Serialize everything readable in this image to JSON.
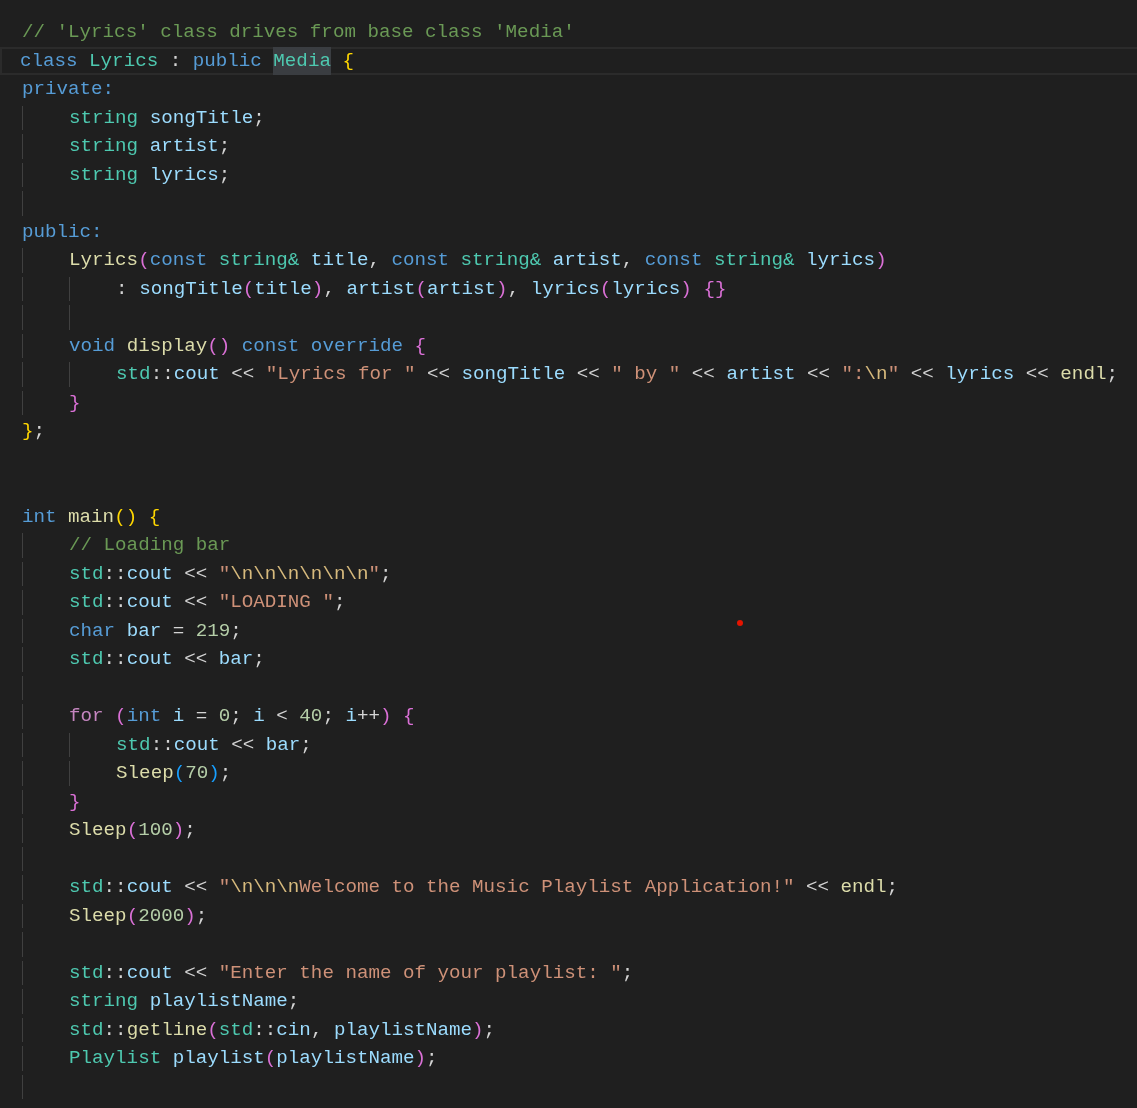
{
  "editor": {
    "lines": [
      {
        "kind": "code",
        "tokens": [
          {
            "kind": "comment",
            "text": "// 'Lyrics' class drives from base class 'Media'"
          }
        ]
      },
      {
        "kind": "code",
        "current": true,
        "tokens": [
          {
            "kind": "keyword",
            "text": "class "
          },
          {
            "kind": "type",
            "text": "Lyrics"
          },
          {
            "kind": "plain",
            "text": " : "
          },
          {
            "kind": "keyword",
            "text": "public "
          },
          {
            "kind": "type",
            "text": "Media",
            "highlighted": true
          },
          {
            "kind": "brace1",
            "text": " {"
          }
        ]
      },
      {
        "kind": "code",
        "tokens": [
          {
            "kind": "keyword",
            "text": "private:"
          }
        ]
      },
      {
        "kind": "code",
        "tokens": [
          {
            "kind": "type",
            "text": "    string"
          },
          {
            "kind": "variable",
            "text": " songTitle"
          },
          {
            "kind": "plain",
            "text": ";"
          }
        ]
      },
      {
        "kind": "code",
        "tokens": [
          {
            "kind": "type",
            "text": "    string"
          },
          {
            "kind": "variable",
            "text": " artist"
          },
          {
            "kind": "plain",
            "text": ";"
          }
        ]
      },
      {
        "kind": "code",
        "tokens": [
          {
            "kind": "type",
            "text": "    string"
          },
          {
            "kind": "variable",
            "text": " lyrics"
          },
          {
            "kind": "plain",
            "text": ";"
          }
        ]
      },
      {
        "kind": "blank"
      },
      {
        "kind": "code",
        "tokens": [
          {
            "kind": "keyword",
            "text": "public:"
          }
        ]
      },
      {
        "kind": "code",
        "tokens": [
          {
            "kind": "function",
            "text": "    Lyrics"
          },
          {
            "kind": "brace2",
            "text": "("
          },
          {
            "kind": "keyword",
            "text": "const "
          },
          {
            "kind": "type",
            "text": "string&"
          },
          {
            "kind": "variable",
            "text": " title"
          },
          {
            "kind": "plain",
            "text": ", "
          },
          {
            "kind": "keyword",
            "text": "const "
          },
          {
            "kind": "type",
            "text": "string&"
          },
          {
            "kind": "variable",
            "text": " artist"
          },
          {
            "kind": "plain",
            "text": ", "
          },
          {
            "kind": "keyword",
            "text": "const "
          },
          {
            "kind": "type",
            "text": "string&"
          },
          {
            "kind": "variable",
            "text": " lyrics"
          },
          {
            "kind": "brace2",
            "text": ")"
          }
        ]
      },
      {
        "kind": "code",
        "tokens": [
          {
            "kind": "plain",
            "text": "        : "
          },
          {
            "kind": "variable",
            "text": "songTitle"
          },
          {
            "kind": "brace2",
            "text": "("
          },
          {
            "kind": "variable",
            "text": "title"
          },
          {
            "kind": "brace2",
            "text": ")"
          },
          {
            "kind": "plain",
            "text": ", "
          },
          {
            "kind": "variable",
            "text": "artist"
          },
          {
            "kind": "brace2",
            "text": "("
          },
          {
            "kind": "variable",
            "text": "artist"
          },
          {
            "kind": "brace2",
            "text": ")"
          },
          {
            "kind": "plain",
            "text": ", "
          },
          {
            "kind": "variable",
            "text": "lyrics"
          },
          {
            "kind": "brace2",
            "text": "("
          },
          {
            "kind": "variable",
            "text": "lyrics"
          },
          {
            "kind": "brace2",
            "text": ")"
          },
          {
            "kind": "brace2",
            "text": " {}"
          }
        ]
      },
      {
        "kind": "blank"
      },
      {
        "kind": "code",
        "tokens": [
          {
            "kind": "keyword",
            "text": "    void "
          },
          {
            "kind": "function",
            "text": "display"
          },
          {
            "kind": "brace2",
            "text": "()"
          },
          {
            "kind": "keyword",
            "text": " const override "
          },
          {
            "kind": "brace2",
            "text": "{"
          }
        ]
      },
      {
        "kind": "code",
        "tokens": [
          {
            "kind": "type",
            "text": "        std"
          },
          {
            "kind": "plain",
            "text": "::"
          },
          {
            "kind": "variable",
            "text": "cout"
          },
          {
            "kind": "plain",
            "text": " << "
          },
          {
            "kind": "string",
            "text": "\"Lyrics for \""
          },
          {
            "kind": "plain",
            "text": " << "
          },
          {
            "kind": "variable",
            "text": "songTitle"
          },
          {
            "kind": "plain",
            "text": " << "
          },
          {
            "kind": "string",
            "text": "\" by \""
          },
          {
            "kind": "plain",
            "text": " << "
          },
          {
            "kind": "variable",
            "text": "artist"
          },
          {
            "kind": "plain",
            "text": " << "
          },
          {
            "kind": "string",
            "text": "\":"
          },
          {
            "kind": "escape",
            "text": "\\n"
          },
          {
            "kind": "string",
            "text": "\""
          },
          {
            "kind": "plain",
            "text": " << "
          },
          {
            "kind": "variable",
            "text": "lyrics"
          },
          {
            "kind": "plain",
            "text": " << "
          },
          {
            "kind": "function",
            "text": "endl"
          },
          {
            "kind": "plain",
            "text": ";"
          }
        ]
      },
      {
        "kind": "code",
        "tokens": [
          {
            "kind": "brace2",
            "text": "    }"
          }
        ]
      },
      {
        "kind": "code",
        "tokens": [
          {
            "kind": "brace1",
            "text": "}"
          },
          {
            "kind": "plain",
            "text": ";"
          }
        ]
      },
      {
        "kind": "blank"
      },
      {
        "kind": "blank"
      },
      {
        "kind": "code",
        "tokens": [
          {
            "kind": "keyword",
            "text": "int "
          },
          {
            "kind": "function",
            "text": "main"
          },
          {
            "kind": "brace1",
            "text": "()"
          },
          {
            "kind": "brace1",
            "text": " {"
          }
        ]
      },
      {
        "kind": "code",
        "tokens": [
          {
            "kind": "comment",
            "text": "    // Loading bar"
          }
        ]
      },
      {
        "kind": "code",
        "tokens": [
          {
            "kind": "type",
            "text": "    std"
          },
          {
            "kind": "plain",
            "text": "::"
          },
          {
            "kind": "variable",
            "text": "cout"
          },
          {
            "kind": "plain",
            "text": " << "
          },
          {
            "kind": "string",
            "text": "\""
          },
          {
            "kind": "escape",
            "text": "\\n\\n\\n\\n\\n\\n"
          },
          {
            "kind": "string",
            "text": "\""
          },
          {
            "kind": "plain",
            "text": ";"
          }
        ]
      },
      {
        "kind": "code",
        "tokens": [
          {
            "kind": "type",
            "text": "    std"
          },
          {
            "kind": "plain",
            "text": "::"
          },
          {
            "kind": "variable",
            "text": "cout"
          },
          {
            "kind": "plain",
            "text": " << "
          },
          {
            "kind": "string",
            "text": "\"LOADING \""
          },
          {
            "kind": "plain",
            "text": ";"
          }
        ]
      },
      {
        "kind": "code",
        "tokens": [
          {
            "kind": "keyword",
            "text": "    char "
          },
          {
            "kind": "variable",
            "text": "bar"
          },
          {
            "kind": "plain",
            "text": " = "
          },
          {
            "kind": "number",
            "text": "219"
          },
          {
            "kind": "plain",
            "text": ";"
          }
        ]
      },
      {
        "kind": "code",
        "tokens": [
          {
            "kind": "type",
            "text": "    std"
          },
          {
            "kind": "plain",
            "text": "::"
          },
          {
            "kind": "variable",
            "text": "cout"
          },
          {
            "kind": "plain",
            "text": " << "
          },
          {
            "kind": "variable",
            "text": "bar"
          },
          {
            "kind": "plain",
            "text": ";"
          }
        ]
      },
      {
        "kind": "blank"
      },
      {
        "kind": "code",
        "tokens": [
          {
            "kind": "control",
            "text": "    for "
          },
          {
            "kind": "brace2",
            "text": "("
          },
          {
            "kind": "keyword",
            "text": "int "
          },
          {
            "kind": "variable",
            "text": "i"
          },
          {
            "kind": "plain",
            "text": " = "
          },
          {
            "kind": "number",
            "text": "0"
          },
          {
            "kind": "plain",
            "text": "; "
          },
          {
            "kind": "variable",
            "text": "i"
          },
          {
            "kind": "plain",
            "text": " < "
          },
          {
            "kind": "number",
            "text": "40"
          },
          {
            "kind": "plain",
            "text": "; "
          },
          {
            "kind": "variable",
            "text": "i"
          },
          {
            "kind": "plain",
            "text": "++"
          },
          {
            "kind": "brace2",
            "text": ")"
          },
          {
            "kind": "brace2",
            "text": " {"
          }
        ]
      },
      {
        "kind": "code",
        "tokens": [
          {
            "kind": "type",
            "text": "        std"
          },
          {
            "kind": "plain",
            "text": "::"
          },
          {
            "kind": "variable",
            "text": "cout"
          },
          {
            "kind": "plain",
            "text": " << "
          },
          {
            "kind": "variable",
            "text": "bar"
          },
          {
            "kind": "plain",
            "text": ";"
          }
        ]
      },
      {
        "kind": "code",
        "tokens": [
          {
            "kind": "function",
            "text": "        Sleep"
          },
          {
            "kind": "brace3",
            "text": "("
          },
          {
            "kind": "number",
            "text": "70"
          },
          {
            "kind": "brace3",
            "text": ")"
          },
          {
            "kind": "plain",
            "text": ";"
          }
        ]
      },
      {
        "kind": "code",
        "tokens": [
          {
            "kind": "brace2",
            "text": "    }"
          }
        ]
      },
      {
        "kind": "code",
        "tokens": [
          {
            "kind": "function",
            "text": "    Sleep"
          },
          {
            "kind": "brace2",
            "text": "("
          },
          {
            "kind": "number",
            "text": "100"
          },
          {
            "kind": "brace2",
            "text": ")"
          },
          {
            "kind": "plain",
            "text": ";"
          }
        ]
      },
      {
        "kind": "blank"
      },
      {
        "kind": "code",
        "tokens": [
          {
            "kind": "type",
            "text": "    std"
          },
          {
            "kind": "plain",
            "text": "::"
          },
          {
            "kind": "variable",
            "text": "cout"
          },
          {
            "kind": "plain",
            "text": " << "
          },
          {
            "kind": "string",
            "text": "\""
          },
          {
            "kind": "escape",
            "text": "\\n\\n\\n"
          },
          {
            "kind": "string",
            "text": "Welcome to the Music Playlist Application!\""
          },
          {
            "kind": "plain",
            "text": " << "
          },
          {
            "kind": "function",
            "text": "endl"
          },
          {
            "kind": "plain",
            "text": ";"
          }
        ]
      },
      {
        "kind": "code",
        "tokens": [
          {
            "kind": "function",
            "text": "    Sleep"
          },
          {
            "kind": "brace2",
            "text": "("
          },
          {
            "kind": "number",
            "text": "2000"
          },
          {
            "kind": "brace2",
            "text": ")"
          },
          {
            "kind": "plain",
            "text": ";"
          }
        ]
      },
      {
        "kind": "blank"
      },
      {
        "kind": "code",
        "tokens": [
          {
            "kind": "type",
            "text": "    std"
          },
          {
            "kind": "plain",
            "text": "::"
          },
          {
            "kind": "variable",
            "text": "cout"
          },
          {
            "kind": "plain",
            "text": " << "
          },
          {
            "kind": "string",
            "text": "\"Enter the name of your playlist: \""
          },
          {
            "kind": "plain",
            "text": ";"
          }
        ]
      },
      {
        "kind": "code",
        "tokens": [
          {
            "kind": "type",
            "text": "    string"
          },
          {
            "kind": "variable",
            "text": " playlistName"
          },
          {
            "kind": "plain",
            "text": ";"
          }
        ]
      },
      {
        "kind": "code",
        "tokens": [
          {
            "kind": "type",
            "text": "    std"
          },
          {
            "kind": "plain",
            "text": "::"
          },
          {
            "kind": "function",
            "text": "getline"
          },
          {
            "kind": "brace2",
            "text": "("
          },
          {
            "kind": "type",
            "text": "std"
          },
          {
            "kind": "plain",
            "text": "::"
          },
          {
            "kind": "variable",
            "text": "cin"
          },
          {
            "kind": "plain",
            "text": ", "
          },
          {
            "kind": "variable",
            "text": "playlistName"
          },
          {
            "kind": "brace2",
            "text": ")"
          },
          {
            "kind": "plain",
            "text": ";"
          }
        ]
      },
      {
        "kind": "code",
        "tokens": [
          {
            "kind": "type",
            "text": "    Playlist"
          },
          {
            "kind": "variable",
            "text": " playlist"
          },
          {
            "kind": "brace2",
            "text": "("
          },
          {
            "kind": "variable",
            "text": "playlistName"
          },
          {
            "kind": "brace2",
            "text": ")"
          },
          {
            "kind": "plain",
            "text": ";"
          }
        ]
      },
      {
        "kind": "blank"
      }
    ]
  }
}
